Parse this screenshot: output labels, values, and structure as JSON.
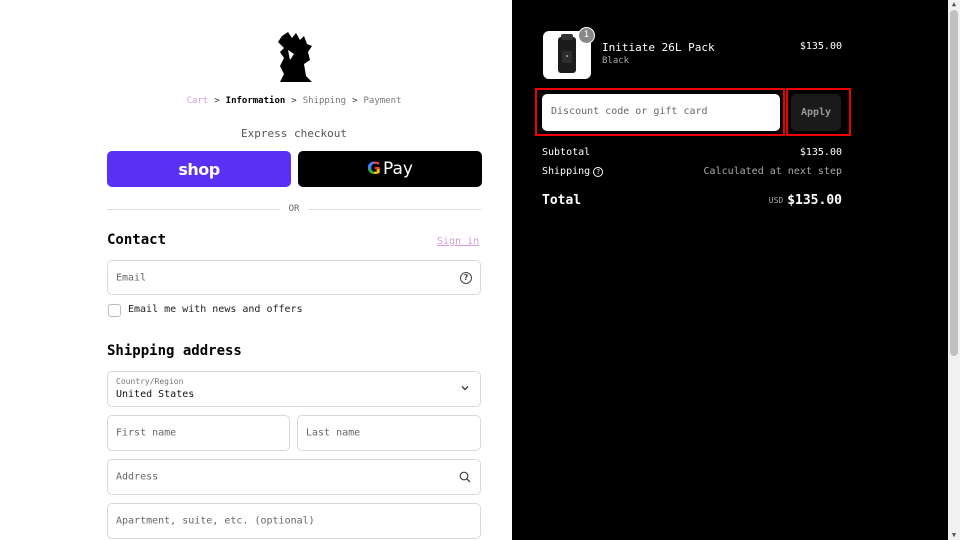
{
  "breadcrumb": {
    "cart": "Cart",
    "information": "Information",
    "shipping": "Shipping",
    "payment": "Payment",
    "separator": ">"
  },
  "express": {
    "label": "Express checkout",
    "shop_label": "shop",
    "gpay_g": "G",
    "gpay_label": "Pay",
    "or_label": "OR"
  },
  "contact": {
    "heading": "Contact",
    "sign_in": "Sign in",
    "email_placeholder": "Email",
    "newsletter_label": "Email me with news and offers"
  },
  "shipping_address": {
    "heading": "Shipping address",
    "country_label": "Country/Region",
    "country_value": "United States",
    "first_name_placeholder": "First name",
    "last_name_placeholder": "Last name",
    "address_placeholder": "Address",
    "apartment_placeholder": "Apartment, suite, etc. (optional)"
  },
  "order": {
    "quantity": "1",
    "product_name": "Initiate 26L Pack",
    "product_variant": "Black",
    "product_price": "$135.00",
    "discount_placeholder": "Discount code or gift card",
    "apply_label": "Apply",
    "subtotal_label": "Subtotal",
    "subtotal_value": "$135.00",
    "shipping_label": "Shipping",
    "shipping_value": "Calculated at next step",
    "total_label": "Total",
    "total_currency": "USD",
    "total_value": "$135.00"
  },
  "colors": {
    "shop_purple": "#5a31f4",
    "link_pink": "#d89be0",
    "highlight_red": "#e00000",
    "summary_bg": "#000000"
  }
}
